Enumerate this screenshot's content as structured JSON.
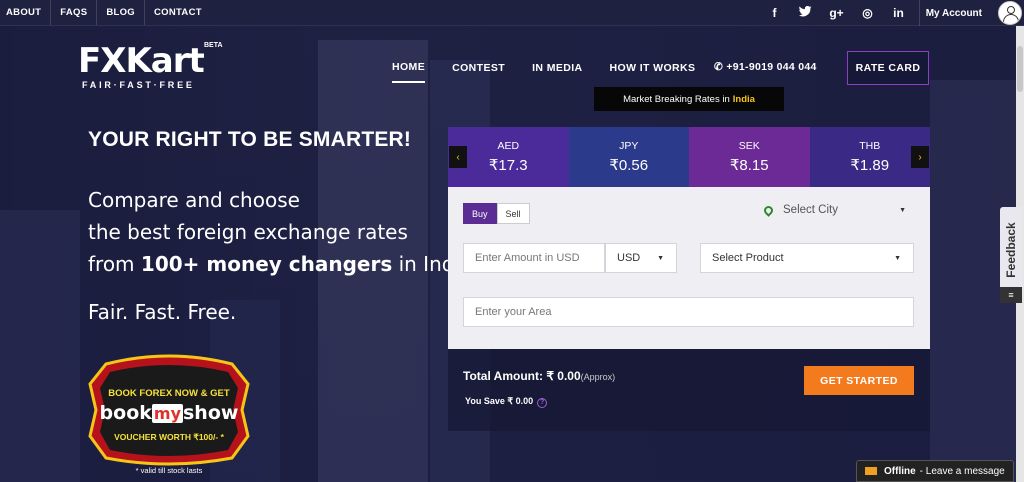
{
  "topbar": {
    "links": [
      "ABOUT",
      "FAQS",
      "BLOG",
      "CONTACT"
    ],
    "social": [
      {
        "icon": "facebook-icon",
        "glyph": "f"
      },
      {
        "icon": "twitter-icon",
        "glyph": "t"
      },
      {
        "icon": "google-plus-icon",
        "glyph": "g+"
      },
      {
        "icon": "instagram-icon",
        "glyph": "◎"
      },
      {
        "icon": "linkedin-icon",
        "glyph": "in"
      }
    ],
    "account_label": "My Account"
  },
  "logo": {
    "brand": "FXKart",
    "beta": "BETA",
    "tagline": "FAIR·FAST·FREE"
  },
  "nav": {
    "items": [
      "HOME",
      "CONTEST",
      "IN MEDIA",
      "HOW IT WORKS"
    ],
    "active": "HOME",
    "phone": "+91-9019 044 044",
    "rate_card": "RATE CARD"
  },
  "market_bar": {
    "text": "Market Breaking Rates in",
    "highlight": "India"
  },
  "hero": {
    "headline": "YOUR RIGHT TO BE SMARTER!",
    "line1": "Compare and choose",
    "line2": "the best foreign exchange rates",
    "line3_pre": "from ",
    "line3_bold": "100+ money changers",
    "line3_post": " in India.",
    "slogan": "Fair. Fast. Free."
  },
  "promo": {
    "line1": "BOOK FOREX NOW & GET",
    "brand_a": "book",
    "brand_b": "my",
    "brand_c": "show",
    "line3": "VOUCHER WORTH ₹100/- *",
    "footnote": "* valid till stock lasts"
  },
  "rates": {
    "prev": "‹",
    "next": "›",
    "items": [
      {
        "code": "AED",
        "value": "₹17.3",
        "color": "#4b2a9a"
      },
      {
        "code": "JPY",
        "value": "₹0.56",
        "color": "#2c3a8c"
      },
      {
        "code": "SEK",
        "value": "₹8.15",
        "color": "#6b2a95"
      },
      {
        "code": "THB",
        "value": "₹1.89",
        "color": "#3a2a86"
      }
    ]
  },
  "form": {
    "buy": "Buy",
    "sell": "Sell",
    "city_placeholder": "Select City",
    "amount_placeholder": "Enter Amount in USD",
    "currency": "USD",
    "product_placeholder": "Select Product",
    "area_placeholder": "Enter your Area"
  },
  "totals": {
    "total_label": "Total Amount:",
    "total_value": "₹ 0.00",
    "approx": "(Approx)",
    "save_label": "You Save",
    "save_value": "₹ 0.00",
    "cta": "GET STARTED"
  },
  "feedback": {
    "label": "Feedback"
  },
  "chat": {
    "status": "Offline",
    "message": "- Leave a message"
  }
}
